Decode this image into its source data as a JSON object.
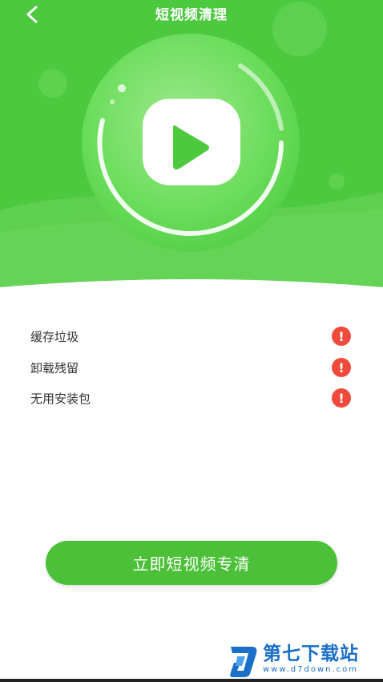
{
  "header": {
    "title": "短视频清理",
    "back_icon": "chevron-left-icon"
  },
  "hero": {
    "icon": "video-play-icon",
    "bg_color": "#4cc93e"
  },
  "issues": [
    {
      "label": "缓存垃圾",
      "status_icon": "warning-icon",
      "status_glyph": "!"
    },
    {
      "label": "卸载残留",
      "status_icon": "warning-icon",
      "status_glyph": "!"
    },
    {
      "label": "无用安装包",
      "status_icon": "warning-icon",
      "status_glyph": "!"
    }
  ],
  "action": {
    "button_label": "立即短视频专清",
    "color": "#4cc038"
  },
  "watermark": {
    "name": "第七下载站",
    "url": "www.d7down.com"
  }
}
